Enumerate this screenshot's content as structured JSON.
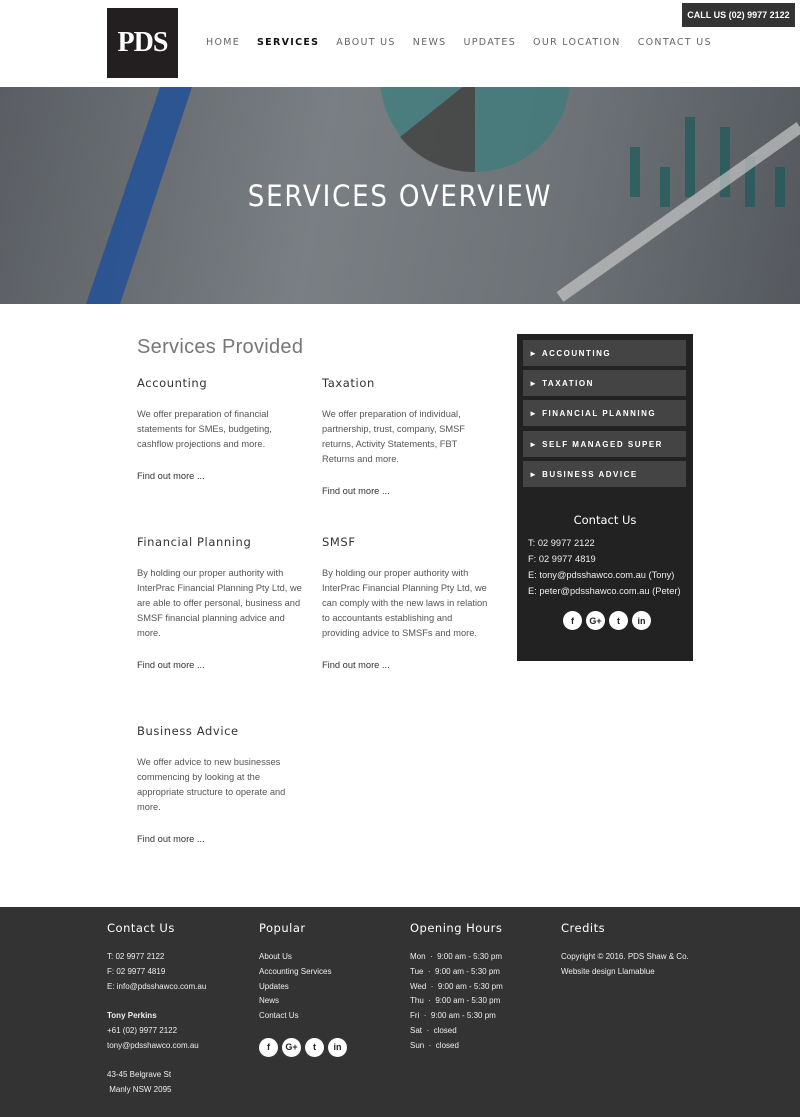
{
  "header": {
    "logo": "PDS",
    "nav": [
      "HOME",
      "SERVICES",
      "ABOUT US",
      "NEWS",
      "UPDATES",
      "OUR LOCATION",
      "CONTACT US"
    ],
    "active": "SERVICES",
    "call": "CALL US (02) 9977 2122"
  },
  "hero": {
    "title": "SERVICES OVERVIEW"
  },
  "main": {
    "title": "Services Provided",
    "find_more": "Find out more ...",
    "services": [
      {
        "title": "Accounting",
        "text": "We offer preparation of financial statements for SMEs, budgeting, cashflow projections and more.",
        "link": "Find out more ..."
      },
      {
        "title": "Taxation",
        "text": "We offer preparation of individual, partnership, trust, company, SMSF returns, Activity Statements, FBT Returns and more.",
        "link": "Find out more ..."
      },
      {
        "title": "Financial Planning",
        "text": "By holding our proper authority with InterPrac Financial Planning Pty Ltd, we are able to offer personal, business and SMSF financial planning advice and more.",
        "link": "Find out more ..."
      },
      {
        "title": "SMSF",
        "text": "By holding our proper authority with InterPrac Financial Planning Pty Ltd, we can comply with the new laws in relation to accountants establishing and providing advice to SMSFs and more.",
        "link": "Find out more ..."
      },
      {
        "title": "Business Advice",
        "text": "We offer advice to new businesses commencing by looking at the appropriate structure to operate and more.",
        "link": "Find out more ..."
      }
    ]
  },
  "sidebar": {
    "buttons": [
      "► ACCOUNTING",
      "► TAXATION",
      "► FINANCIAL PLANNING",
      "► SELF MANAGED SUPER",
      "► BUSINESS ADVICE"
    ],
    "contact_title": "Contact Us",
    "contact": [
      "T: 02 9977 2122",
      "F: 02 9977 4819",
      "E: tony@pdsshawco.com.au (Tony)",
      "E: peter@pdsshawco.com.au (Peter)"
    ],
    "social": [
      "f",
      "G+",
      "t",
      "in"
    ]
  },
  "footer": {
    "contact": {
      "title": "Contact Us",
      "lines": [
        "T: 02 9977 2122",
        "F: 02 9977 4819",
        "E: info@pdsshawco.com.au"
      ],
      "name": "Tony Perkins",
      "person": [
        "+61 (02) 9977 2122",
        "tony@pdsshawco.com.au"
      ],
      "address": [
        "43-45 Belgrave St",
        " Manly NSW 2095"
      ]
    },
    "popular": {
      "title": "Popular",
      "links": [
        "About Us",
        "Accounting Services",
        "Updates",
        "News",
        "Contact Us"
      ]
    },
    "hours": {
      "title": "Opening Hours",
      "lines": [
        "Mon  ·  9:00 am - 5:30 pm",
        "Tue  ·  9:00 am - 5:30 pm",
        "Wed  ·  9:00 am - 5:30 pm",
        "Thu  ·  9:00 am - 5:30 pm",
        "Fri  ·  9:00 am - 5:30 pm",
        "Sat  ·  closed",
        "Sun  ·  closed"
      ]
    },
    "credits": {
      "title": "Credits",
      "lines": [
        "Copyright © 2016. PDS Shaw & Co.",
        "Website design Llamablue"
      ]
    }
  }
}
